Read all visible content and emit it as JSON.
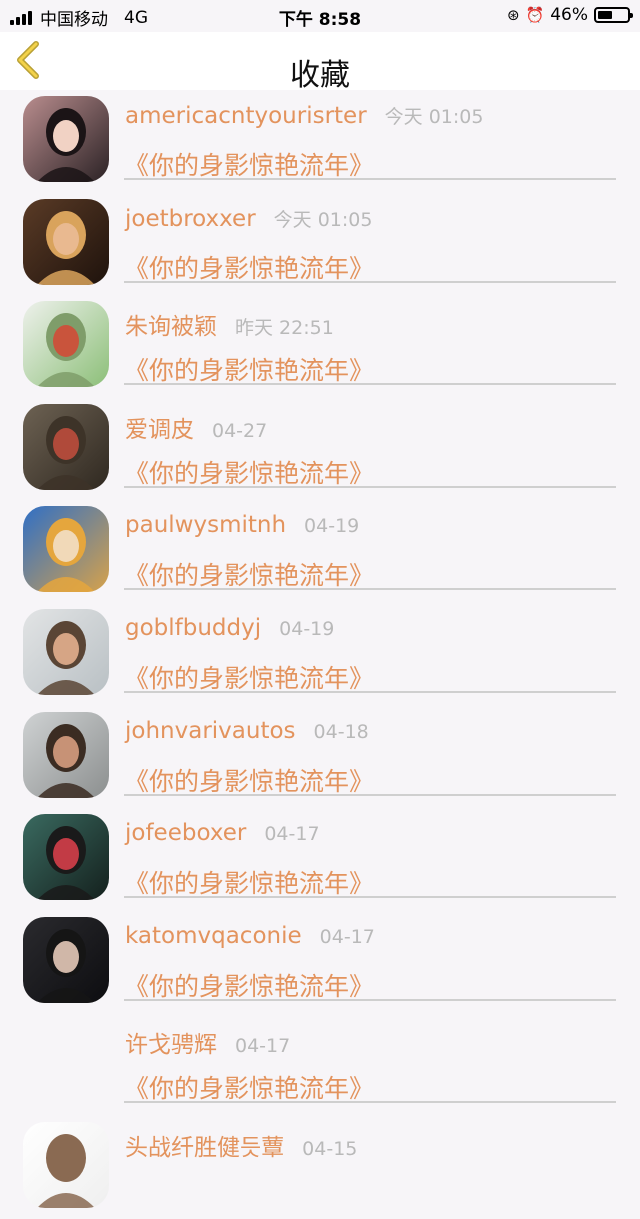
{
  "status": {
    "carrier": "中国移动",
    "network": "4G",
    "time": "下午 8:58",
    "battery": "46%"
  },
  "nav": {
    "title": "收藏"
  },
  "items": [
    {
      "name": "americacntyourisrter",
      "date": "今天 01:05",
      "text": "《你的身影惊艳流年》",
      "avatar": {
        "bg": "#b98d8e",
        "bg2": "#2b2225",
        "face": "#f1d2c4",
        "hair": "#1b1416"
      }
    },
    {
      "name": "joetbroxxer",
      "date": "今天 01:05",
      "text": "《你的身影惊艳流年》",
      "avatar": {
        "bg": "#5a3b26",
        "bg2": "#1e120c",
        "face": "#e9b990",
        "hair": "#d9a35c"
      }
    },
    {
      "name": "朱询被颖",
      "date": "昨天 22:51",
      "text": "《你的身影惊艳流年》",
      "avatar": {
        "bg": "#eef1ec",
        "bg2": "#8cbf78",
        "face": "#c9543c",
        "hair": "#7f9d6a"
      }
    },
    {
      "name": "爱调皮",
      "date": "04-27",
      "text": "《你的身影惊艳流年》",
      "avatar": {
        "bg": "#6d6253",
        "bg2": "#2f2820",
        "face": "#b04a3a",
        "hair": "#3d3328"
      }
    },
    {
      "name": "paulwysmitnh",
      "date": "04-19",
      "text": "《你的身影惊艳流年》",
      "avatar": {
        "bg": "#2f6fc6",
        "bg2": "#d7a24a",
        "face": "#f1d9b8",
        "hair": "#e5a63d"
      }
    },
    {
      "name": "goblfbuddyj",
      "date": "04-19",
      "text": "《你的身影惊艳流年》",
      "avatar": {
        "bg": "#e2e4e5",
        "bg2": "#b9c0c4",
        "face": "#d6a585",
        "hair": "#5a4535"
      }
    },
    {
      "name": "johnvarivautos",
      "date": "04-18",
      "text": "《你的身影惊艳流年》",
      "avatar": {
        "bg": "#cfd2d3",
        "bg2": "#8c8f8f",
        "face": "#c79276",
        "hair": "#3b2c22"
      }
    },
    {
      "name": "jofeeboxer",
      "date": "04-17",
      "text": "《你的身影惊艳流年》",
      "avatar": {
        "bg": "#3a6a60",
        "bg2": "#14201d",
        "face": "#c23b45",
        "hair": "#1a1a1a"
      }
    },
    {
      "name": "katomvqaconie",
      "date": "04-17",
      "text": "《你的身影惊艳流年》",
      "avatar": {
        "bg": "#2a2a2e",
        "bg2": "#0d0d10",
        "face": "#d0b7a8",
        "hair": "#151515"
      }
    },
    {
      "name": "许戈骋辉",
      "date": "04-17",
      "text": "《你的身影惊艳流年》",
      "avatar": null
    },
    {
      "name": "头战纤胜健듯蕈",
      "date": "04-15",
      "text": "",
      "avatar": {
        "bg": "#ffffff",
        "bg2": "#efefef",
        "face": "#8a6a52",
        "hair": "#8a6a52"
      }
    }
  ]
}
